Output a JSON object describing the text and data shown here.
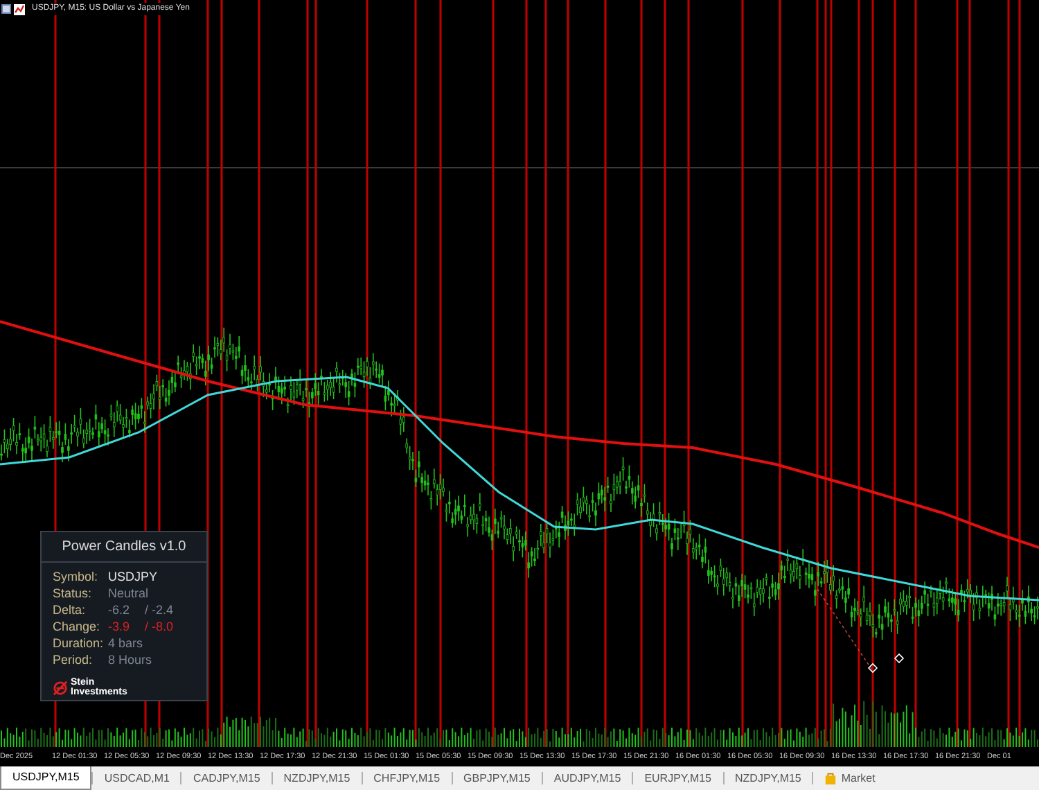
{
  "chart": {
    "title": "USDJPY, M15: US Dollar vs Japanese Yen"
  },
  "panel": {
    "title": "Power Candles v1.0",
    "rows": [
      {
        "label": "Symbol:",
        "values": [
          {
            "text": "USDJPY",
            "color": "#e6e6e6"
          }
        ]
      },
      {
        "label": "Status:",
        "values": [
          {
            "text": "Neutral",
            "color": "#7d8590"
          }
        ]
      },
      {
        "label": "Delta:",
        "values": [
          {
            "text": "-6.2",
            "color": "#7d8590"
          },
          {
            "text": "/ -2.4",
            "color": "#7d8590"
          }
        ]
      },
      {
        "label": "Change:",
        "values": [
          {
            "text": "-3.9",
            "color": "#e02020"
          },
          {
            "text": "/ -8.0",
            "color": "#e02020"
          }
        ]
      },
      {
        "label": "Duration:",
        "values": [
          {
            "text": "4 bars",
            "color": "#7d8590"
          }
        ]
      },
      {
        "label": "Period:",
        "values": [
          {
            "text": "8 Hours",
            "color": "#7d8590"
          }
        ]
      }
    ],
    "logo": {
      "line1": "Stein",
      "line2": "Investments"
    }
  },
  "x_axis": {
    "labels": [
      "Dec 2025",
      "12 Dec 01:30",
      "12 Dec 05:30",
      "12 Dec 09:30",
      "12 Dec 13:30",
      "12 Dec 17:30",
      "12 Dec 21:30",
      "15 Dec 01:30",
      "15 Dec 05:30",
      "15 Dec 09:30",
      "15 Dec 13:30",
      "15 Dec 17:30",
      "15 Dec 21:30",
      "16 Dec 01:30",
      "16 Dec 05:30",
      "16 Dec 09:30",
      "16 Dec 13:30",
      "16 Dec 17:30",
      "16 Dec 21:30",
      "Dec 01"
    ]
  },
  "tabs": [
    {
      "label": "USDJPY,M15",
      "kind": "chart",
      "selected": true
    },
    {
      "label": "USDCAD,M1",
      "kind": "chart",
      "selected": false
    },
    {
      "label": "CADJPY,M15",
      "kind": "chart",
      "selected": false
    },
    {
      "label": "NZDJPY,M15",
      "kind": "chart",
      "selected": false
    },
    {
      "label": "CHFJPY,M15",
      "kind": "chart",
      "selected": false
    },
    {
      "label": "GBPJPY,M15",
      "kind": "chart",
      "selected": false
    },
    {
      "label": "AUDJPY,M15",
      "kind": "chart",
      "selected": false
    },
    {
      "label": "EURJPY,M15",
      "kind": "chart",
      "selected": false
    },
    {
      "label": "NZDJPY,M15",
      "kind": "chart",
      "selected": false
    },
    {
      "label": "Market",
      "kind": "market",
      "selected": false
    }
  ]
}
